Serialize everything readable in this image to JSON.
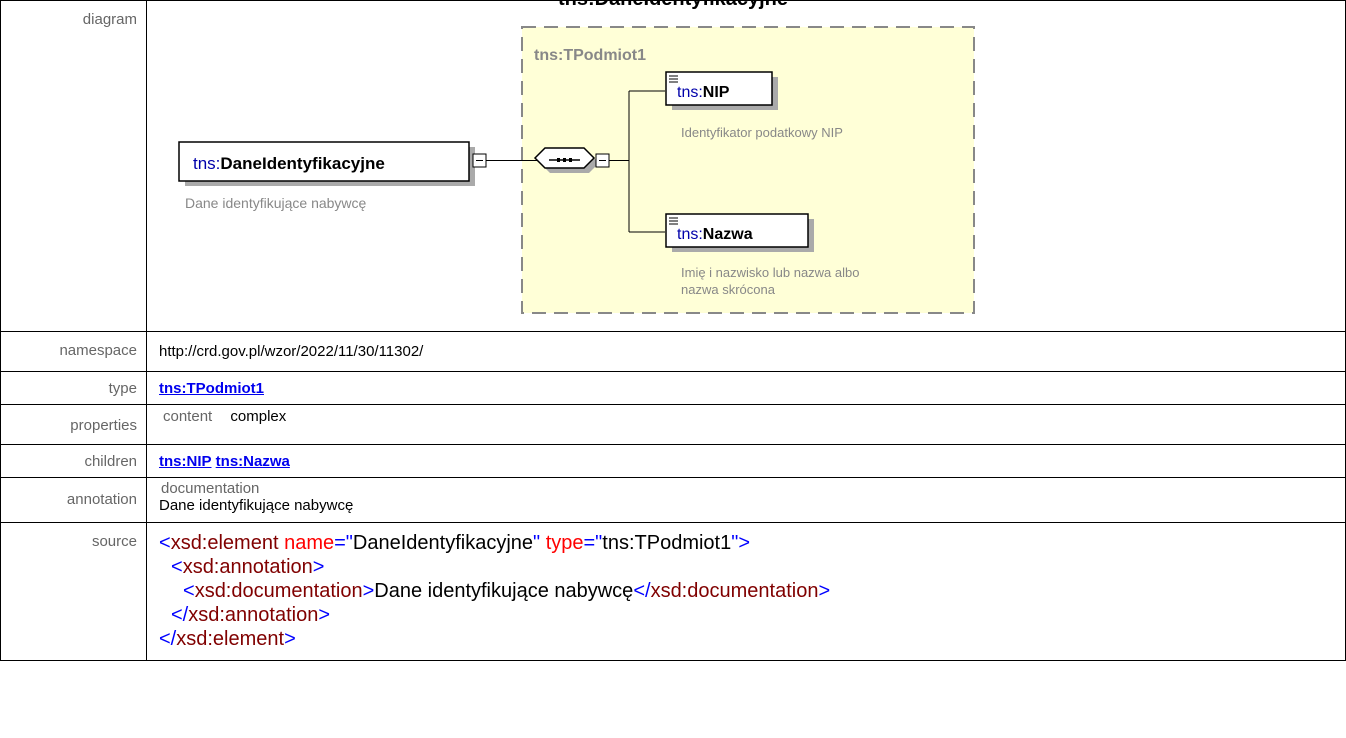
{
  "page_title": "tns:DaneIdentyfikacyjne",
  "labels": {
    "diagram": "diagram",
    "namespace": "namespace",
    "type": "type",
    "properties": "properties",
    "children": "children",
    "annotation": "annotation",
    "source": "source"
  },
  "diagram": {
    "element_prefix": "tns:",
    "element_name": "DaneIdentyfikacyjne",
    "element_doc": "Dane identyfikujące nabywcę",
    "type_box_label": "tns:TPodmiot1",
    "child1_prefix": "tns:",
    "child1_name": "NIP",
    "child1_doc": "Identyfikator podatkowy NIP",
    "child2_prefix": "tns:",
    "child2_name": "Nazwa",
    "child2_doc_line1": "Imię i nazwisko lub nazwa albo",
    "child2_doc_line2": "nazwa skrócona",
    "colors": {
      "type_box_fill": "#ffffd7",
      "type_box_border": "#888888",
      "doc_text": "#888888"
    }
  },
  "namespace": "http://crd.gov.pl/wzor/2022/11/30/11302/",
  "type_link": "tns:TPodmiot1",
  "properties": {
    "key": "content",
    "value": "complex"
  },
  "children": [
    "tns:NIP",
    "tns:Nazwa"
  ],
  "annotation": {
    "key": "documentation",
    "value": "Dane identyfikujące nabywcę"
  },
  "source": {
    "l1_open": "<",
    "l1_tag": "xsd:element",
    "l1_attr1": "name",
    "l1_eq1": "=\"",
    "l1_val1": "DaneIdentyfikacyjne",
    "l1_q1": "\"",
    "l1_attr2": "type",
    "l1_eq2": "=\"",
    "l1_val2": "tns:TPodmiot1",
    "l1_close": "\">",
    "l2_open": "<",
    "l2_tag": "xsd:annotation",
    "l2_close": ">",
    "l3_open": "<",
    "l3_tag": "xsd:documentation",
    "l3_close": ">",
    "l3_text": "Dane identyfikujące nabywcę",
    "l3_open2": "</",
    "l3_tag2": "xsd:documentation",
    "l3_close2": ">",
    "l4_open": "</",
    "l4_tag": "xsd:annotation",
    "l4_close": ">",
    "l5_open": "</",
    "l5_tag": "xsd:element",
    "l5_close": ">"
  }
}
